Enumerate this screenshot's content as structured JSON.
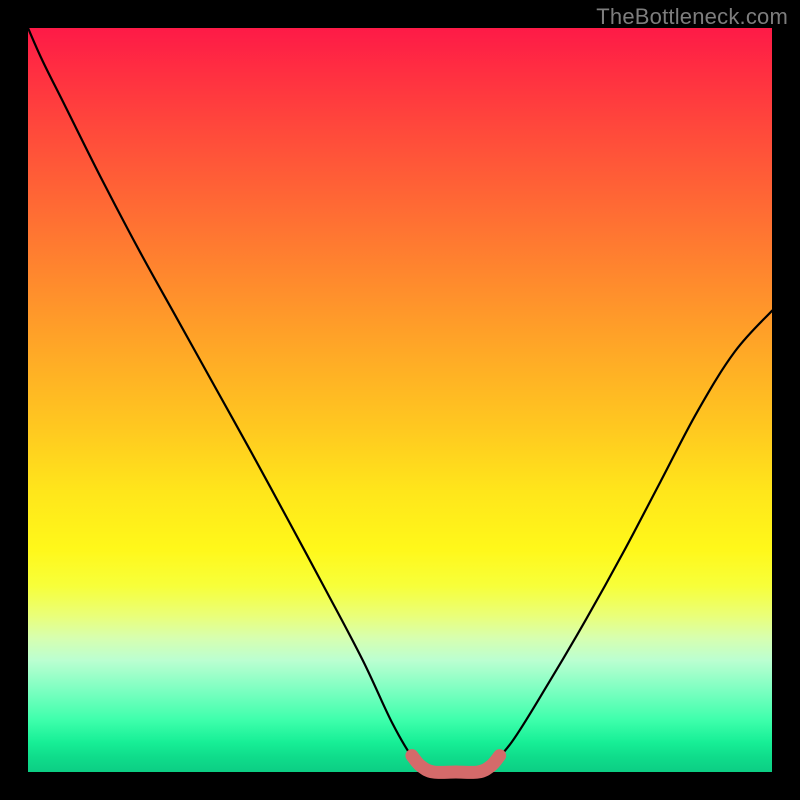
{
  "watermark": "TheBottleneck.com",
  "chart_data": {
    "type": "line",
    "title": "",
    "xlabel": "",
    "ylabel": "",
    "xlim": [
      0,
      1
    ],
    "ylim": [
      0,
      1
    ],
    "series": [
      {
        "name": "bottleneck-curve",
        "x": [
          0.0,
          0.02,
          0.05,
          0.1,
          0.15,
          0.2,
          0.25,
          0.3,
          0.35,
          0.4,
          0.45,
          0.49,
          0.52,
          0.54,
          0.57,
          0.6,
          0.62,
          0.65,
          0.7,
          0.75,
          0.8,
          0.85,
          0.9,
          0.95,
          1.0
        ],
        "values": [
          1.0,
          0.955,
          0.895,
          0.795,
          0.7,
          0.61,
          0.52,
          0.43,
          0.338,
          0.245,
          0.15,
          0.065,
          0.015,
          0.0,
          0.0,
          0.0,
          0.01,
          0.04,
          0.12,
          0.205,
          0.295,
          0.39,
          0.485,
          0.565,
          0.62
        ]
      },
      {
        "name": "minimum-highlight",
        "x": [
          0.516,
          0.528,
          0.545,
          0.575,
          0.605,
          0.622,
          0.634
        ],
        "values": [
          0.022,
          0.008,
          0.0,
          0.0,
          0.0,
          0.008,
          0.022
        ]
      }
    ],
    "annotations": []
  },
  "colors": {
    "curve": "#000000",
    "highlight": "#d46a6a",
    "background_border": "#000000"
  }
}
